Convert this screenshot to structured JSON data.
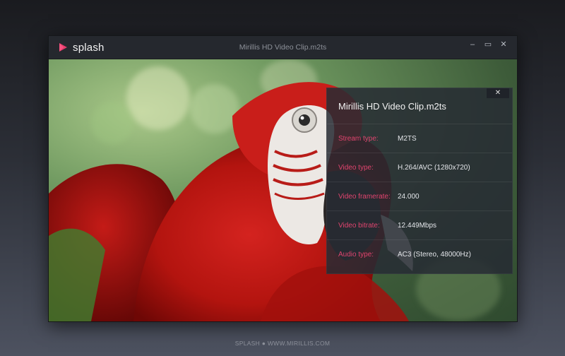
{
  "app": {
    "logo_text": "splash",
    "window_title": "Mirillis HD Video Clip.m2ts",
    "controls": {
      "minimize": "–",
      "maximize": "▭",
      "close": "✕"
    }
  },
  "info_panel": {
    "title": "Mirillis HD Video Clip.m2ts",
    "close_label": "✕",
    "rows": [
      {
        "label": "Stream type:",
        "value": "M2TS"
      },
      {
        "label": "Video type:",
        "value": "H.264/AVC (1280x720)"
      },
      {
        "label": "Video framerate:",
        "value": "24.000"
      },
      {
        "label": "Video bitrate:",
        "value": "12.449Mbps"
      },
      {
        "label": "Audio type:",
        "value": "AC3 (Stereo, 48000Hz)"
      }
    ]
  },
  "footer": {
    "text": "SPLASH  ●  WWW.MIRILLIS.COM"
  },
  "colors": {
    "accent": "#e0446e",
    "panel_bg": "#262b33"
  }
}
